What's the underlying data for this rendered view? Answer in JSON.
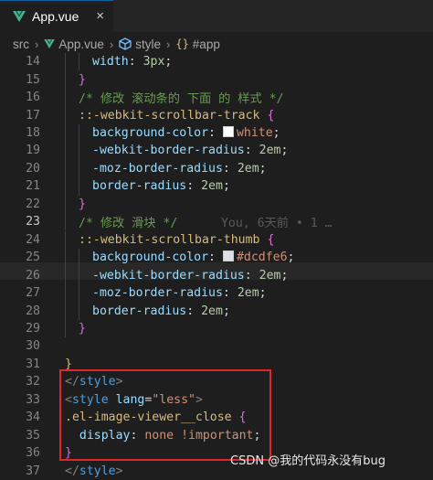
{
  "tab": {
    "title": "App.vue",
    "close_icon": "×"
  },
  "breadcrumb": {
    "folder": "src",
    "file": "App.vue",
    "section": "style",
    "selector": "#app"
  },
  "lines": [
    {
      "n": "14",
      "tokens": [
        [
          "c-prop",
          "width"
        ],
        [
          "c-punc",
          ": "
        ],
        [
          "c-num",
          "3px"
        ],
        [
          "c-punc",
          ";"
        ]
      ],
      "indent": 2
    },
    {
      "n": "15",
      "tokens": [
        [
          "c-brace",
          "}"
        ]
      ],
      "indent": 1
    },
    {
      "n": "16",
      "tokens": [
        [
          "c-comment",
          "/* 修改 滚动条的 下面 的 样式 */"
        ]
      ],
      "indent": 1
    },
    {
      "n": "17",
      "tokens": [
        [
          "c-sel",
          "::-webkit-scrollbar-track"
        ],
        [
          "c-punc",
          " "
        ],
        [
          "c-brace",
          "{"
        ]
      ],
      "indent": 1
    },
    {
      "n": "18",
      "tokens": [
        [
          "c-prop",
          "background-color"
        ],
        [
          "c-punc",
          ": "
        ],
        [
          "swatch",
          "#ffffff"
        ],
        [
          "c-val",
          "white"
        ],
        [
          "c-punc",
          ";"
        ]
      ],
      "indent": 2
    },
    {
      "n": "19",
      "tokens": [
        [
          "c-prop",
          "-webkit-border-radius"
        ],
        [
          "c-punc",
          ": "
        ],
        [
          "c-num",
          "2em"
        ],
        [
          "c-punc",
          ";"
        ]
      ],
      "indent": 2
    },
    {
      "n": "20",
      "tokens": [
        [
          "c-prop",
          "-moz-border-radius"
        ],
        [
          "c-punc",
          ": "
        ],
        [
          "c-num",
          "2em"
        ],
        [
          "c-punc",
          ";"
        ]
      ],
      "indent": 2
    },
    {
      "n": "21",
      "tokens": [
        [
          "c-prop",
          "border-radius"
        ],
        [
          "c-punc",
          ": "
        ],
        [
          "c-num",
          "2em"
        ],
        [
          "c-punc",
          ";"
        ]
      ],
      "indent": 2
    },
    {
      "n": "22",
      "tokens": [
        [
          "c-brace",
          "}"
        ]
      ],
      "indent": 1
    },
    {
      "n": "23",
      "tokens": [
        [
          "c-comment",
          "/* 修改 滑块 */"
        ],
        [
          "c-blame",
          "      You, 6天前 • 1 …"
        ]
      ],
      "indent": 1,
      "active": true
    },
    {
      "n": "24",
      "tokens": [
        [
          "c-sel",
          "::-webkit-scrollbar-thumb"
        ],
        [
          "c-punc",
          " "
        ],
        [
          "c-brace",
          "{"
        ]
      ],
      "indent": 1
    },
    {
      "n": "25",
      "tokens": [
        [
          "c-prop",
          "background-color"
        ],
        [
          "c-punc",
          ": "
        ],
        [
          "swatch",
          "#dcdfe6"
        ],
        [
          "c-val",
          "#dcdfe6"
        ],
        [
          "c-punc",
          ";"
        ]
      ],
      "indent": 2
    },
    {
      "n": "26",
      "tokens": [
        [
          "c-prop",
          "-webkit-border-radius"
        ],
        [
          "c-punc",
          ": "
        ],
        [
          "c-num",
          "2em"
        ],
        [
          "c-punc",
          ";"
        ]
      ],
      "indent": 2
    },
    {
      "n": "27",
      "tokens": [
        [
          "c-prop",
          "-moz-border-radius"
        ],
        [
          "c-punc",
          ": "
        ],
        [
          "c-num",
          "2em"
        ],
        [
          "c-punc",
          ";"
        ]
      ],
      "indent": 2
    },
    {
      "n": "28",
      "tokens": [
        [
          "c-prop",
          "border-radius"
        ],
        [
          "c-punc",
          ": "
        ],
        [
          "c-num",
          "2em"
        ],
        [
          "c-punc",
          ";"
        ]
      ],
      "indent": 2
    },
    {
      "n": "29",
      "tokens": [
        [
          "c-brace",
          "}"
        ]
      ],
      "indent": 1
    },
    {
      "n": "30",
      "tokens": [],
      "indent": 0
    },
    {
      "n": "31",
      "tokens": [
        [
          "c-sel",
          "}"
        ]
      ],
      "indent": 0
    },
    {
      "n": "32",
      "tokens": [
        [
          "c-gray",
          "</"
        ],
        [
          "c-tag",
          "style"
        ],
        [
          "c-gray",
          ">"
        ]
      ],
      "indent": -1
    },
    {
      "n": "33",
      "tokens": [
        [
          "c-gray",
          "<"
        ],
        [
          "c-tag",
          "style"
        ],
        [
          "c-punc",
          " "
        ],
        [
          "c-attr",
          "lang"
        ],
        [
          "c-punc",
          "="
        ],
        [
          "c-val",
          "\"less\""
        ],
        [
          "c-gray",
          ">"
        ]
      ],
      "indent": -1
    },
    {
      "n": "34",
      "tokens": [
        [
          "c-sel",
          ".el-image-viewer__close"
        ],
        [
          "c-punc",
          " "
        ],
        [
          "c-brace",
          "{"
        ]
      ],
      "indent": -1
    },
    {
      "n": "35",
      "tokens": [
        [
          "c-punc",
          "  "
        ],
        [
          "c-prop",
          "display"
        ],
        [
          "c-punc",
          ": "
        ],
        [
          "c-val",
          "none"
        ],
        [
          "c-punc",
          " "
        ],
        [
          "c-val",
          "!important"
        ],
        [
          "c-punc",
          ";"
        ]
      ],
      "indent": -1
    },
    {
      "n": "36",
      "tokens": [
        [
          "c-brace",
          "}"
        ]
      ],
      "indent": -1
    },
    {
      "n": "37",
      "tokens": [
        [
          "c-gray",
          "</"
        ],
        [
          "c-tag",
          "style"
        ],
        [
          "c-gray",
          ">"
        ]
      ],
      "indent": -1
    }
  ],
  "watermark": "CSDN @我的代码永没有bug"
}
